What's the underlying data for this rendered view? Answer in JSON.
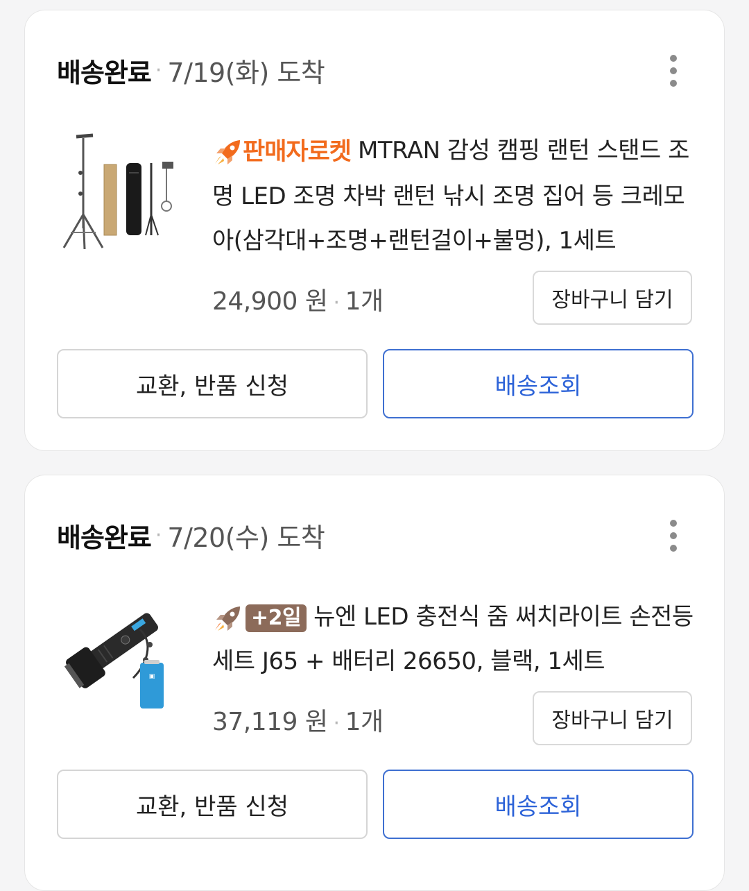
{
  "orders": [
    {
      "status": "배송완료",
      "separator": "·",
      "arrival": "7/19(화) 도착",
      "more_icon": "more-vertical-icon",
      "product": {
        "image_icon": "camping-lantern-stand-image",
        "badge_icon": "rocket-icon",
        "badge_text": "판매자로켓",
        "badge_color": "#f26b1d",
        "title": "MTRAN 감성 캠핑 랜턴 스탠드 조명 LED 조명 차박 랜턴 낚시 조명 집어 등 크레모아(삼각대+조명+랜턴걸이+불멍), 1세트",
        "price": "24,900 원",
        "quantity": "1개"
      },
      "cart_label": "장바구니 담기",
      "return_label": "교환, 반품 신청",
      "track_label": "배송조회"
    },
    {
      "status": "배송완료",
      "separator": "·",
      "arrival": "7/20(수) 도착",
      "more_icon": "more-vertical-icon",
      "product": {
        "image_icon": "flashlight-battery-image",
        "badge_icon": "rocket-icon",
        "badge_text": "+2일",
        "badge_color": "#8c6b5a",
        "title": "뉴엔 LED 충전식 줌 써치라이트 손전등 세트 J65 + 배터리 26650, 블랙, 1세트",
        "price": "37,119 원",
        "quantity": "1개"
      },
      "cart_label": "장바구니 담기",
      "return_label": "교환, 반품 신청",
      "track_label": "배송조회"
    }
  ],
  "colors": {
    "accent_blue": "#2d63d8",
    "rocket_orange": "#f26b1d",
    "text_dark": "#111111",
    "text_gray": "#555555"
  }
}
